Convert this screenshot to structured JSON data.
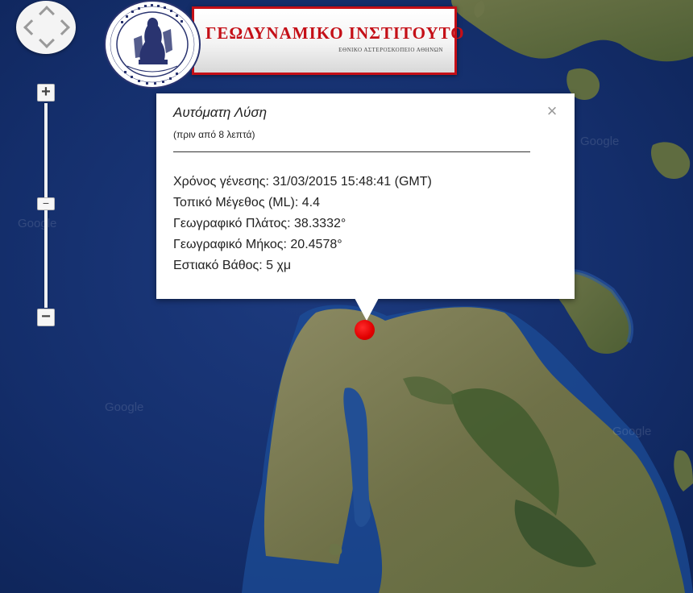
{
  "map": {
    "watermark": "Google",
    "type": "satellite"
  },
  "controls": {
    "pan_icon": "pan-arrows-icon",
    "zoom_in_label": "+",
    "zoom_out_label": "−",
    "zoom_thumb_label": "−"
  },
  "logo": {
    "title": "ΓΕΩΔΥΝΑΜΙΚΟ ΙΝΣΤΙΤΟΥΤΟ",
    "subtitle": "ΕΘΝΙΚΟ ΑΣΤΕΡΟΣΚΟΠΕΙΟ ΑΘΗΝΩΝ",
    "seal_text": "ΕΘΝΙΚΟΝ ΑΣΤΕΡΟΣΚΟΠΕΙΟΝ ΑΘΗΝΩΝ · NATIONAL OBSERVATORY ATHENS",
    "brand_color": "#c40f17"
  },
  "popup": {
    "title": "Αυτόματη Λύση",
    "subtitle": "(πριν από 8 λεπτά)",
    "close_label": "×",
    "rows": [
      "Χρόνος γένεσης: 31/03/2015  15:48:41 (GMT)",
      "Τοπικό Μέγεθος (ML): 4.4",
      "Γεωγραφικό Πλάτος: 38.3332°",
      "Γεωγραφικό Μήκος: 20.4578°",
      "Εστιακό Βάθος: 5 χμ"
    ]
  },
  "marker": {
    "color": "#e00000"
  }
}
